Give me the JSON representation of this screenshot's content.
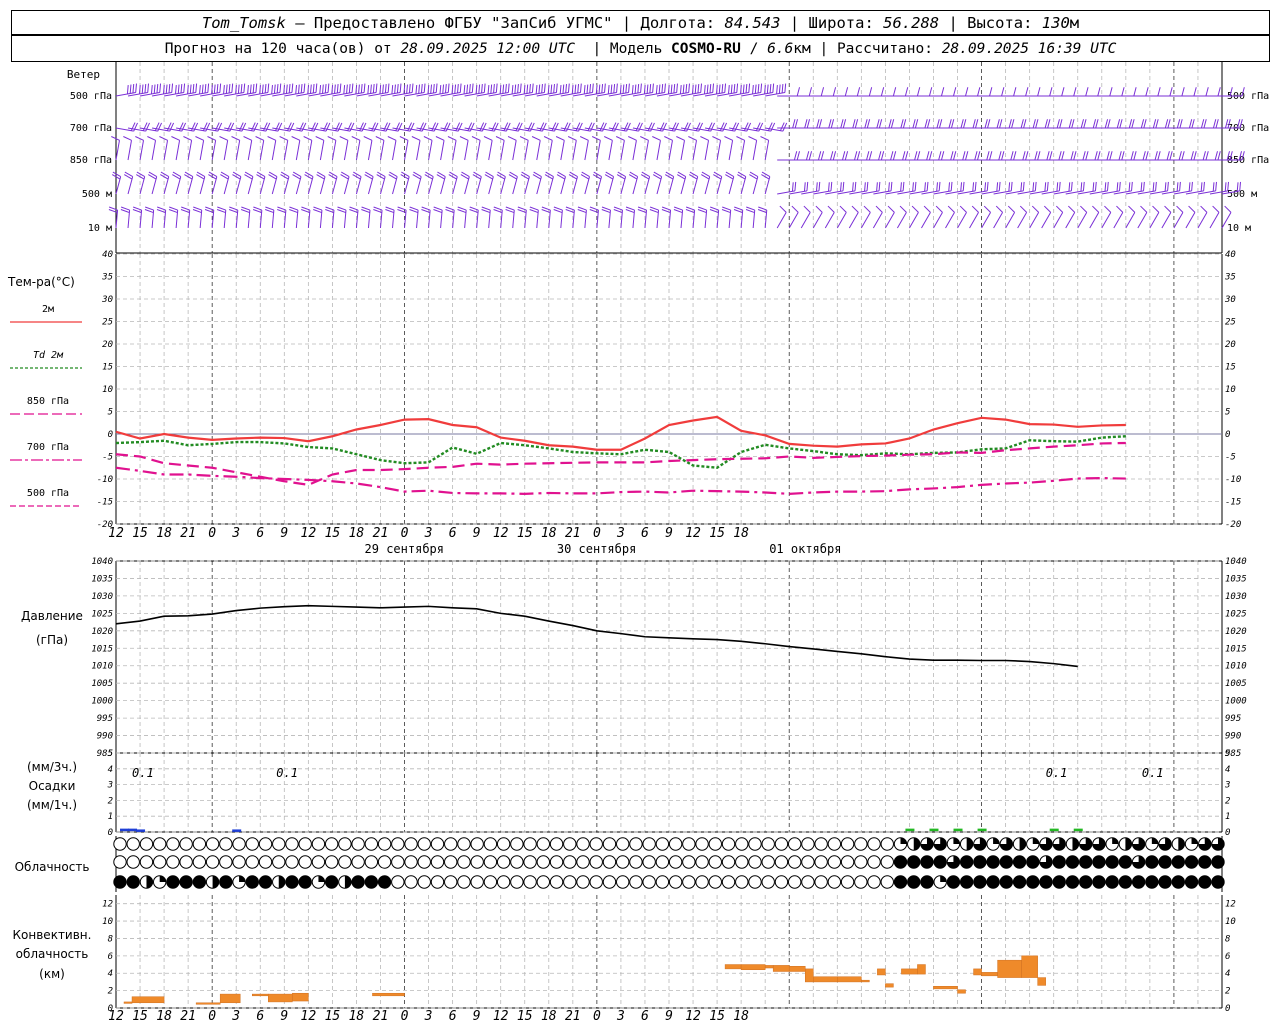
{
  "header": {
    "station": "Tom_Tomsk",
    "dash": " – ",
    "provided": "Предоставлено ФГБУ \"ЗапСиб УГМС\"",
    "sep": " | ",
    "lon_label": "Долгота: ",
    "lon_value": "84.543",
    "lat_label": "Широта: ",
    "lat_value": "56.288",
    "alt_label": "Высота: ",
    "alt_value": "130",
    "alt_unit": "м",
    "forecast_label": "Прогноз на 120 часа(ов) от ",
    "forecast_time": "28.09.2025 12:00 UTC",
    "model_label": "  | Модель ",
    "model_name": "COSMO-RU",
    "model_res_sep": " / ",
    "model_res": "6.6",
    "model_res_unit": "км",
    "calc_label": " | Рассчитано: ",
    "calc_time": "28.09.2025 16:39 UTC"
  },
  "wind_panel": {
    "title": "Ветер",
    "levels": [
      "500 гПа",
      "700 гПа",
      "850 гПа",
      "500 м",
      "10  м"
    ],
    "right_levels": [
      "500 гПа",
      "700 гПа",
      "850 гПа",
      "500 м",
      "10  м"
    ],
    "color": "#7a2fd6"
  },
  "temp_panel": {
    "title": "Тем-ра(°C)",
    "legend": [
      {
        "label": "2м",
        "color": "#f03c3c"
      },
      {
        "label": "Td 2м",
        "color": "#228b22"
      },
      {
        "label": "850 гПа",
        "color": "#e0118f"
      },
      {
        "label": "700 гПа",
        "color": "#e0118f"
      },
      {
        "label": "500 гПа",
        "color": "#e0118f"
      }
    ]
  },
  "pressure_panel": {
    "title": "Давление",
    "unit": "(гПа)"
  },
  "precip_panel": {
    "unit1": "(мм/3ч.)",
    "title": "Осадки",
    "unit2": "(мм/1ч.)",
    "annotations": [
      "0.1",
      "0.1",
      "0.1",
      "0.1"
    ]
  },
  "cloud_panel": {
    "title": "Облачность"
  },
  "conv_panel": {
    "title1": "Конвективн.",
    "title2": "облачность",
    "unit": "(км)"
  },
  "x_axis": {
    "tick_labels": [
      "12",
      "15",
      "18",
      "21",
      "0",
      "3",
      "6",
      "9",
      "12",
      "15",
      "18",
      "21",
      "0",
      "3",
      "6",
      "9",
      "12",
      "15",
      "18",
      "21",
      "0",
      "3",
      "6",
      "9",
      "12",
      "15",
      "18"
    ],
    "dates": [
      "29 сентября",
      "30 сентября",
      "01 октября"
    ]
  },
  "chart_data": [
    {
      "type": "line",
      "title": "Тем-ра(°C)",
      "x_unit": "hours from 28.09.2025 12:00 UTC",
      "ylim": [
        -20,
        40
      ],
      "y_ticks": [
        -20,
        -15,
        -10,
        -5,
        0,
        5,
        10,
        15,
        20,
        25,
        30,
        35,
        40
      ],
      "x": [
        0,
        3,
        6,
        9,
        12,
        15,
        18,
        21,
        24,
        27,
        30,
        33,
        36,
        39,
        42,
        45,
        48,
        51,
        54,
        57,
        60,
        63,
        66,
        69,
        72,
        75,
        78,
        81,
        84,
        87,
        90,
        93,
        96,
        99,
        102,
        105,
        108,
        111,
        114,
        117,
        120,
        123,
        126,
        129,
        132,
        135,
        138
      ],
      "series": [
        {
          "name": "2м",
          "color": "#f03c3c",
          "values": [
            0.5,
            -1,
            0,
            -0.8,
            -1.3,
            -1,
            -0.8,
            -0.9,
            -1.6,
            -0.5,
            1,
            2,
            3.2,
            3.3,
            2,
            1.5,
            -0.8,
            -1.5,
            -2.5,
            -2.8,
            -3.5,
            -3.5,
            -1,
            2,
            3,
            3.8,
            0.7,
            -0.3,
            -2.2,
            -2.6,
            -2.8,
            -2.3,
            -2.1,
            -1,
            1,
            2.4,
            3.6,
            3.2,
            2.2,
            2.1,
            1.6,
            1.9,
            2
          ]
        },
        {
          "name": "Td 2м",
          "color": "#228b22",
          "values": [
            -2,
            -1.8,
            -1.5,
            -2.5,
            -2.2,
            -1.8,
            -1.8,
            -2.1,
            -2.9,
            -3.2,
            -4.5,
            -5.8,
            -6.5,
            -6.3,
            -3,
            -4.4,
            -2,
            -2.5,
            -3.2,
            -4,
            -4.3,
            -4.5,
            -3.5,
            -4,
            -7,
            -7.5,
            -4,
            -2.4,
            -3.2,
            -3.8,
            -4.5,
            -4.7,
            -4.3,
            -4.5,
            -4.2,
            -4.1,
            -3.4,
            -3.2,
            -1.4,
            -1.6,
            -1.7,
            -0.8,
            -0.5
          ]
        },
        {
          "name": "850 гПа",
          "color": "#e0118f",
          "values": [
            -4.5,
            -5,
            -6.5,
            -7,
            -7.5,
            -8.5,
            -9.5,
            -10.5,
            -11.3,
            -9,
            -8,
            -8,
            -7.8,
            -7.5,
            -7.3,
            -6.6,
            -6.8,
            -6.6,
            -6.5,
            -6.4,
            -6.3,
            -6.3,
            -6.3,
            -6,
            -5.8,
            -5.6,
            -5.5,
            -5.4,
            -5,
            -5.3,
            -5.1,
            -4.9,
            -4.8,
            -4.6,
            -4.5,
            -4.1,
            -4.2,
            -3.6,
            -3.2,
            -2.8,
            -2.5,
            -2.1,
            -2
          ]
        },
        {
          "name": "700 гПа",
          "color": "#e0118f",
          "values": [
            -7.5,
            -8.2,
            -9,
            -9,
            -9.3,
            -9.5,
            -9.8,
            -10,
            -10.2,
            -10.5,
            -11,
            -11.8,
            -12.8,
            -12.6,
            -13.1,
            -13.2,
            -13.2,
            -13.3,
            -13.1,
            -13.2,
            -13.2,
            -12.9,
            -12.8,
            -13,
            -12.6,
            -12.7,
            -12.8,
            -13,
            -13.3,
            -13,
            -12.8,
            -12.8,
            -12.7,
            -12.3,
            -12.1,
            -11.8,
            -11.3,
            -11,
            -10.8,
            -10.4,
            -9.9,
            -9.8,
            -9.9
          ]
        }
      ]
    },
    {
      "type": "line",
      "title": "Давление",
      "ylabel": "(гПа)",
      "ylim": [
        985,
        1040
      ],
      "y_ticks": [
        985,
        990,
        995,
        1000,
        1005,
        1010,
        1015,
        1020,
        1025,
        1030,
        1035,
        1040
      ],
      "x": [
        0,
        3,
        6,
        9,
        12,
        15,
        18,
        21,
        24,
        27,
        30,
        33,
        36,
        39,
        42,
        45,
        48,
        51,
        54,
        57,
        60,
        63,
        66,
        69,
        72,
        75,
        78,
        81,
        84,
        87,
        90,
        93,
        96,
        99,
        102,
        105,
        108,
        111,
        114,
        117,
        120
      ],
      "series": [
        {
          "name": "",
          "color": "#000000",
          "values": [
            1022,
            1022.8,
            1024.2,
            1024.3,
            1024.8,
            1025.8,
            1026.5,
            1026.9,
            1027.2,
            1027,
            1026.8,
            1026.6,
            1026.8,
            1027,
            1026.6,
            1026.3,
            1025,
            1024.2,
            1022.8,
            1021.5,
            1020,
            1019.2,
            1018.3,
            1018,
            1017.7,
            1017.5,
            1017,
            1016.3,
            1015.5,
            1014.8,
            1014.1,
            1013.4,
            1012.6,
            1011.9,
            1011.6,
            1011.6,
            1011.5,
            1011.5,
            1011.2,
            1010.6,
            1009.8
          ]
        }
      ]
    },
    {
      "type": "bar",
      "title": "Осадки",
      "ylim": [
        0,
        5
      ],
      "y_ticks": [
        0,
        1,
        2,
        3,
        4,
        5
      ],
      "x": [
        1,
        2,
        3,
        15,
        99,
        102,
        105,
        108,
        117,
        120
      ],
      "series": [
        {
          "name": "",
          "color": "#1f3fd6",
          "values": [
            0.15,
            0.15,
            0.1,
            0.1,
            0,
            0,
            0,
            0,
            0,
            0
          ]
        },
        {
          "name": "",
          "color": "#23b823",
          "values": [
            0,
            0,
            0,
            0,
            0.15,
            0.15,
            0.15,
            0.15,
            0.15,
            0.15
          ]
        }
      ]
    },
    {
      "type": "bar",
      "title": "Конвективн. облачность",
      "ylabel": "(км)",
      "ylim": [
        0,
        13
      ],
      "y_ticks": [
        0,
        2,
        4,
        6,
        8,
        10,
        12
      ],
      "bars": [
        {
          "x0": 1,
          "x1": 2,
          "bottom": 0.6,
          "top": 0.7
        },
        {
          "x0": 2,
          "x1": 6,
          "bottom": 0.6,
          "top": 1.3
        },
        {
          "x0": 10,
          "x1": 13,
          "bottom": 0.5,
          "top": 0.6
        },
        {
          "x0": 13,
          "x1": 15.5,
          "bottom": 0.6,
          "top": 1.6
        },
        {
          "x0": 17,
          "x1": 19,
          "bottom": 1.4,
          "top": 1.6
        },
        {
          "x0": 19,
          "x1": 22,
          "bottom": 0.7,
          "top": 1.6
        },
        {
          "x0": 22,
          "x1": 24,
          "bottom": 0.8,
          "top": 1.7
        },
        {
          "x0": 32,
          "x1": 36,
          "bottom": 1.4,
          "top": 1.7
        },
        {
          "x0": 76,
          "x1": 78,
          "bottom": 4.5,
          "top": 5
        },
        {
          "x0": 78,
          "x1": 81,
          "bottom": 4.4,
          "top": 5
        },
        {
          "x0": 81,
          "x1": 82,
          "bottom": 4.6,
          "top": 4.9
        },
        {
          "x0": 82,
          "x1": 84,
          "bottom": 4.2,
          "top": 4.9
        },
        {
          "x0": 84,
          "x1": 86,
          "bottom": 4.2,
          "top": 4.8
        },
        {
          "x0": 86,
          "x1": 87,
          "bottom": 3,
          "top": 4.5
        },
        {
          "x0": 87,
          "x1": 90,
          "bottom": 3,
          "top": 3.6
        },
        {
          "x0": 90,
          "x1": 93,
          "bottom": 3,
          "top": 3.6
        },
        {
          "x0": 93,
          "x1": 94,
          "bottom": 3,
          "top": 3.2
        },
        {
          "x0": 95,
          "x1": 96,
          "bottom": 3.8,
          "top": 4.5
        },
        {
          "x0": 96,
          "x1": 97,
          "bottom": 2.4,
          "top": 2.8
        },
        {
          "x0": 98,
          "x1": 100,
          "bottom": 3.9,
          "top": 4.5
        },
        {
          "x0": 100,
          "x1": 101,
          "bottom": 3.9,
          "top": 5
        },
        {
          "x0": 102,
          "x1": 105,
          "bottom": 2.2,
          "top": 2.5
        },
        {
          "x0": 105,
          "x1": 106,
          "bottom": 1.7,
          "top": 2.1
        },
        {
          "x0": 107,
          "x1": 108,
          "bottom": 3.8,
          "top": 4.5
        },
        {
          "x0": 108,
          "x1": 110,
          "bottom": 3.7,
          "top": 4.1
        },
        {
          "x0": 110,
          "x1": 113,
          "bottom": 3.5,
          "top": 5.5
        },
        {
          "x0": 113,
          "x1": 115,
          "bottom": 3.5,
          "top": 6
        },
        {
          "x0": 115,
          "x1": 116,
          "bottom": 2.6,
          "top": 3.5
        }
      ],
      "color": "#ef8a2a"
    }
  ]
}
